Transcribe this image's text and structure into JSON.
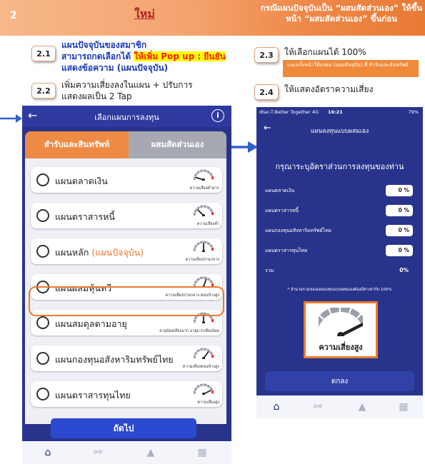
{
  "annotation": {
    "step": "2",
    "title": "ใหม่",
    "header_note": "กรณีแผนปัจจุบันเป็น “ผสมสัดส่วนเอง” ให้ขึ้นหน้า “ผสมสัดส่วนเอง” ขึ้นก่อน",
    "items": [
      {
        "num": "2.1",
        "line1": "แผนปัจจุบันของสมาชิก",
        "line2_plain": "สามารถกดเลือกได้",
        "line2_highlight": "ให้เพิ่ม Pop up : ยืนยัน",
        "line3": "แสดงข้อความ (แผนปัจจุบัน)"
      },
      {
        "num": "2.2",
        "line1": "เพิ่มความเสี่ยงลงในแผน + ปรับการ",
        "line2": "แสดงผลเป็น 2 Tap"
      },
      {
        "num": "2.3",
        "line1": "ให้เลือกแผนได้ 100%",
        "sub_note": "และครั้งหน้าให้แสดง (แผนปัจจุบัน) ที่ สำรับและสินทรัพย์"
      },
      {
        "num": "2.4",
        "line1": "ให้แสดงอัตราความเสี่ยง"
      }
    ]
  },
  "left_phone": {
    "title": "เลือกแผนการลงทุน",
    "info_icon": "i",
    "tabs": [
      "สำรับและสินทรัพท์",
      "ผสมสัดส่วนเอง"
    ],
    "plans": [
      {
        "name": "แผนตลาดเงิน",
        "suffix": "",
        "risk": "ความเสี่ยงต่ำมาก",
        "level": 0.1
      },
      {
        "name": "แผนตราสารหนี้",
        "suffix": "",
        "risk": "ความเสี่ยงต่ำ",
        "level": 0.25
      },
      {
        "name": "แผนหลัก",
        "suffix": "(แผนปัจจุบัน)",
        "risk": "ความเสี่ยงปานกลาง",
        "level": 0.5
      },
      {
        "name": "แผนผสมหุ้นทวี",
        "suffix": "",
        "risk": "ความเสี่ยงปานกลาง ค่อนข้างสูง",
        "level": 0.6
      },
      {
        "name": "แผนสมดุลตามอายุ",
        "suffix": "",
        "risk": "อายุน้อยเสี่ยงมาก อายุมากเสี่ยงน้อย",
        "level": 0.5
      },
      {
        "name": "แผนกองทุนอสังหาริมทรัพย์ไทย",
        "suffix": "",
        "risk": "ความเสี่ยงค่อนข้างสูง",
        "level": 0.7
      },
      {
        "name": "แผนตราสารทุนไทย",
        "suffix": "",
        "risk": "ความเสี่ยงสูง",
        "level": 0.85
      }
    ],
    "next_button": "ถัดไป"
  },
  "right_phone": {
    "status": {
      "carrier": "dtac-T.Better Together  4G",
      "time": "16:21",
      "battery": "79%"
    },
    "title": "แผนลงทุนแบบผสมเอง",
    "prompt": "กรุณาระบุอัตราส่วนการลงทุนของท่าน",
    "allocations": [
      {
        "label": "แผนตลาดเงิน",
        "value": "0 %"
      },
      {
        "label": "แผนตราสารหนี้",
        "value": "0 %"
      },
      {
        "label": "แผนกองทุนอสังหาริมทรัพย์ไทย",
        "value": "0 %"
      },
      {
        "label": "แผนตราสารทุนไทย",
        "value": "0 %"
      }
    ],
    "total_label": "รวม",
    "total_value": "0%",
    "rule_note": "* จำนวนรวมของแผนลงทุนแบบผสมเองต้องมีค่าเท่ากับ 100%",
    "risk_label": "ความเสี่ยงสูง",
    "risk_level": 0.85,
    "ok_button": "ตกลง"
  },
  "nav_icons": [
    "home-icon",
    "notification-icon",
    "bell-icon",
    "grid-icon"
  ],
  "colors": {
    "orange": "#ee8a44",
    "navy": "#28348c",
    "blue_button": "#2b4ad1",
    "accent_red": "#b22222"
  }
}
